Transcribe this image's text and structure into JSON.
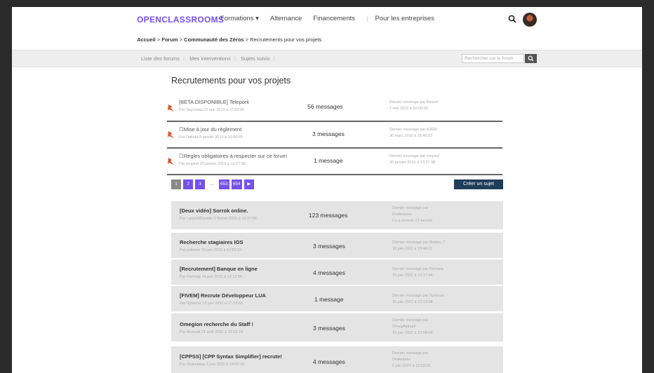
{
  "header": {
    "logo": "OPENCLASSROOMS",
    "menu": [
      "Formations ▾",
      "Alternance",
      "Financements",
      "Pour les entreprises"
    ],
    "search_icon": "search-icon",
    "avatar_icon": "avatar"
  },
  "breadcrumb": {
    "item1": "Accueil",
    "item2": "Forum",
    "item3": "Communauté des Zéros",
    "current": "Recrutements pour vos projets",
    "separator": " > "
  },
  "subnav": {
    "links": [
      "Liste des forums",
      "Mes interventions",
      "Sujets suivis"
    ],
    "search_placeholder": "Rechercher sur le forum"
  },
  "page_title": "Recrutements pour vos projets",
  "pinned": [
    {
      "title": "[BETA DISPONIBLE] Telepork",
      "meta": "Par Sayonara 22 mai 2014 à 10:33:06",
      "count": "56 messages",
      "last1": "Dernier message par Besset",
      "last2": "7 mai 2022 à 15:08:05"
    },
    {
      "title": "Mise à jour du règlement",
      "meta": "Par Dakota 8 janvier 2019 à 10:50:55",
      "count": "3 messages",
      "last1": "Dernier message par AJ666",
      "last2": "30 mars 2019 à 16:46:53"
    },
    {
      "title": "Règles obligatoires à respecter sur ce forum",
      "meta": "Par empirel 20 janvier 2019 à 13:27:38",
      "count": "1 message",
      "last1": "Dernier message par empirel",
      "last2": "20 janvier 2019 à 13:27:38"
    }
  ],
  "pagination": [
    "1",
    "2",
    "3",
    "...",
    "653",
    "654",
    "▶"
  ],
  "create_button": "Créer un sujet",
  "topics": [
    {
      "title": "[Deux vidéo] Sorrok online.",
      "meta": "Par LaurentDuvalle 3 février 2019 à 10:37:06",
      "count": "123 messages",
      "last1": "Dernier message par",
      "last2": "Dratkekeke",
      "last3": "Il y a environ 21 heures"
    },
    {
      "title": "Recherche stagiaires IOS",
      "meta": "Par jedmine 15 juin 2022 à 10:55:03",
      "count": "3 messages",
      "last1": "Dernier message par Mellen_7",
      "last2": "16 juin 2022 à 10:48:21"
    },
    {
      "title": "[Recrutement] Banque en ligne",
      "meta": "Par Kiemaip 14 juin 2022 à 12:12:54",
      "count": "4 messages",
      "last1": "Dernier message par Kiemaip",
      "last2": "15 juin 2022 à 12:17:44"
    },
    {
      "title": "[FIVEM] Recrute Développeur LUA",
      "meta": "Par Syntesiz 15 juin 2022 à 17:13:58",
      "count": "1 message",
      "last1": "Dernier message par Syntesiz",
      "last2": "15 juin 2022 à 17:13:58"
    },
    {
      "title": "Omegion recherche du Staff !",
      "meta": "Par Acnwatt 21 avril 2022 à 13:55:19",
      "count": "3 messages",
      "last1": "Dernier message par",
      "last2": "OmegAlphaIII",
      "last3": "15 juin 2022 à 10:58:04"
    },
    {
      "title": "[CPPSS] [CPP Syntax Simplifier] recrute!",
      "meta": "Par Drakekeke 3 juin 2022 à 14:32:26",
      "count": "4 messages",
      "last1": "Dernier message par",
      "last2": "Drakekeke",
      "last3": "5 juin 2022 à 15:53:21"
    }
  ],
  "colors": {
    "accent": "#7451eb",
    "dark_button": "#1f3d5a",
    "topic_bg": "#e4e4e4",
    "pin_icon": "#d9532b"
  }
}
